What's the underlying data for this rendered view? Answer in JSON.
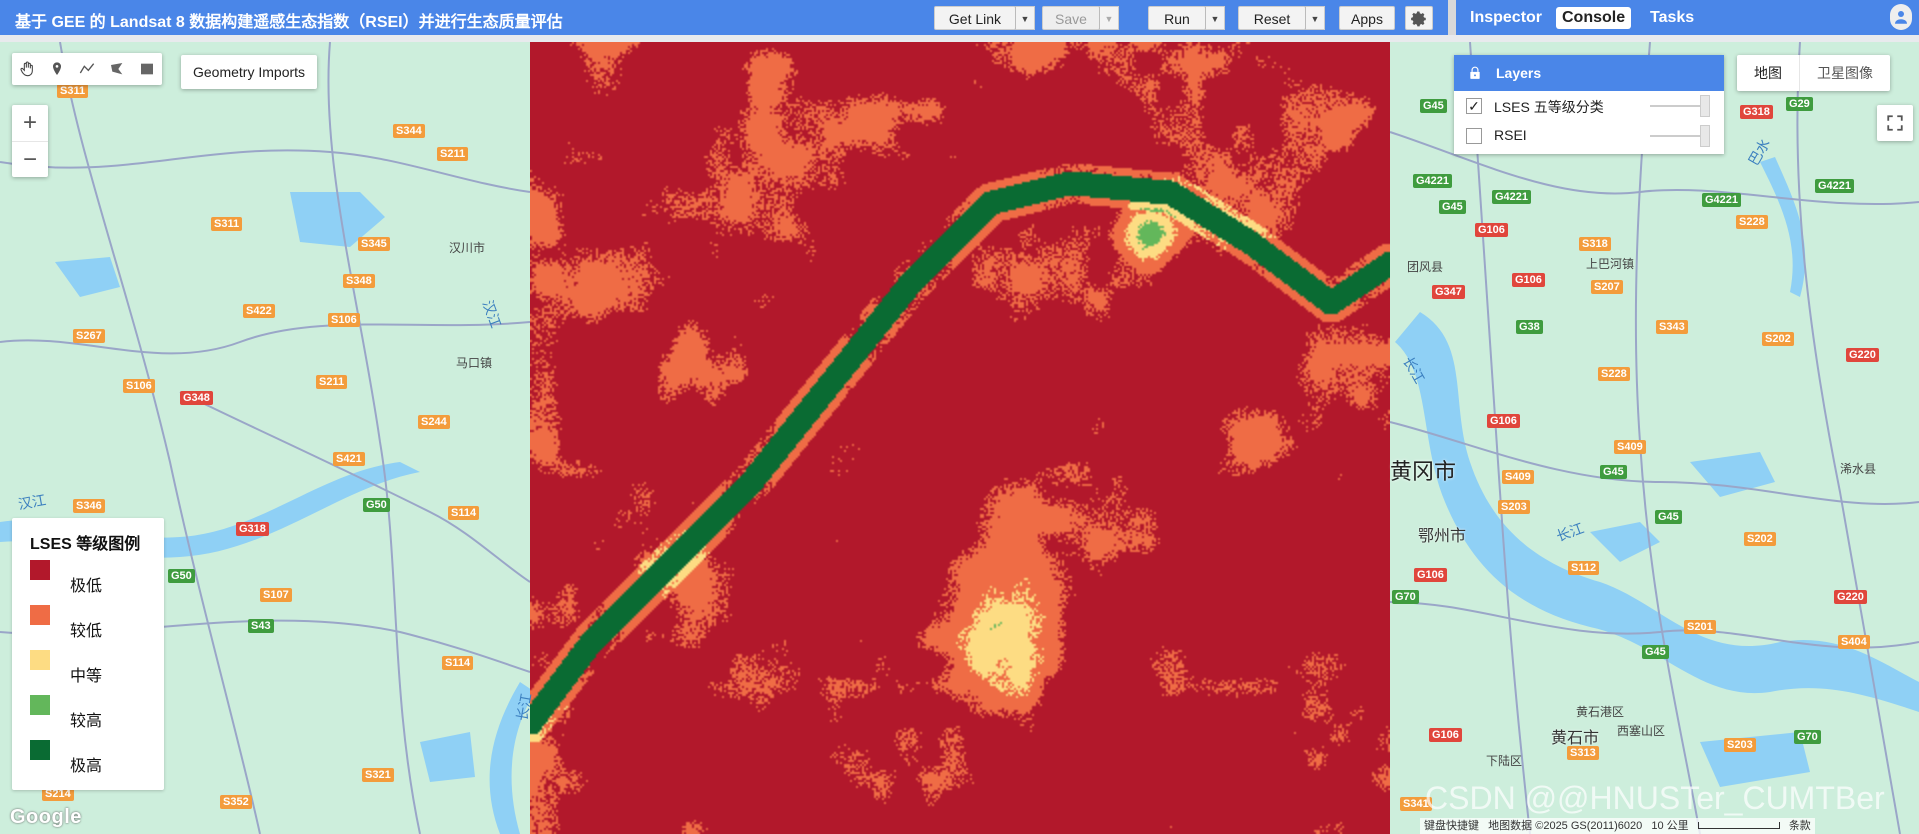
{
  "title": "基于 GEE 的 Landsat 8 数据构建遥感生态指数（RSEI）并进行生态质量评估",
  "toolbar": {
    "get_link": "Get Link",
    "save": "Save",
    "run": "Run",
    "reset": "Reset",
    "apps": "Apps"
  },
  "right_tabs": {
    "inspector": "Inspector",
    "console": "Console",
    "tasks": "Tasks",
    "active": "Console"
  },
  "map_tools": {
    "geometry_imports": "Geometry Imports",
    "zoom_in": "+",
    "zoom_out": "−"
  },
  "layers": {
    "header": "Layers",
    "items": [
      {
        "name": "LSES 五等级分类",
        "checked": true
      },
      {
        "name": "RSEI",
        "checked": false
      }
    ]
  },
  "map_type": {
    "map": "地图",
    "satellite": "卫星图像"
  },
  "legend": {
    "title": "LSES 等级图例",
    "items": [
      {
        "label": "极低",
        "color": "#b2182b"
      },
      {
        "label": "较低",
        "color": "#ef6c45"
      },
      {
        "label": "中等",
        "color": "#fddc83"
      },
      {
        "label": "较高",
        "color": "#63b75b"
      },
      {
        "label": "极高",
        "color": "#0a6b33"
      }
    ]
  },
  "basemap_labels": {
    "cities": [
      "黄冈市",
      "鄂州市",
      "黄石市"
    ],
    "towns": [
      "汉川市",
      "马口镇",
      "团风县",
      "上巴河镇",
      "浠水县",
      "黄石港区",
      "西塞山区",
      "下陆区"
    ],
    "rivers": [
      "汉江",
      "汉江",
      "长江",
      "长江",
      "长江",
      "巴水"
    ],
    "routes": [
      "S311",
      "S344",
      "S211",
      "S311",
      "S345",
      "S348",
      "S422",
      "S106",
      "S267",
      "S211",
      "S106",
      "G348",
      "S244",
      "S421",
      "G50",
      "S346",
      "G318",
      "S114",
      "G50",
      "S107",
      "S43",
      "S114",
      "S321",
      "S352",
      "S214",
      "G45",
      "G4221",
      "G45",
      "G4221",
      "G318",
      "G29",
      "G4221",
      "G106",
      "S318",
      "G4221",
      "S228",
      "G347",
      "G106",
      "S207",
      "G38",
      "S343",
      "S202",
      "G220",
      "S228",
      "G106",
      "S409",
      "G45",
      "S409",
      "S203",
      "G45",
      "S202",
      "G106",
      "S112",
      "G220",
      "G70",
      "S201",
      "G45",
      "S404",
      "G106",
      "S313",
      "S203",
      "G70",
      "S341"
    ]
  },
  "footer": {
    "keyboard": "键盘快捷键",
    "mapdata": "地图数据 ©2025 GS(2011)6020",
    "scale": "10 公里",
    "terms": "条款"
  },
  "google_logo": "Google",
  "watermark": "CSDN @@HNUSTer_CUMTBer",
  "colors": {
    "accent": "#4a86e8",
    "road_shield_orange": "#f39c3c",
    "road_shield_green": "#3f9c3f"
  }
}
